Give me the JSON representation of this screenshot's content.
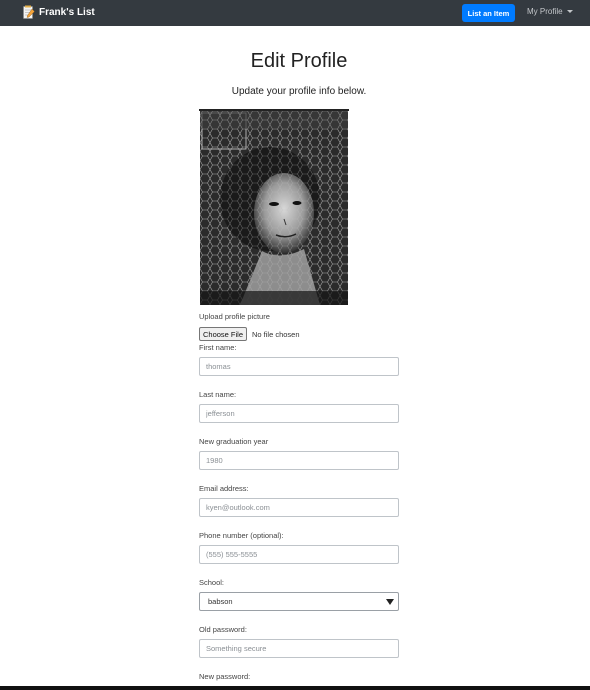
{
  "navbar": {
    "brand": "Frank's List",
    "list_item_label": "List an Item",
    "profile_menu_label": "My Profile"
  },
  "page": {
    "title": "Edit Profile",
    "subtitle": "Update your profile info below."
  },
  "upload": {
    "label": "Upload profile picture",
    "button_label": "Choose File",
    "status": "No file chosen"
  },
  "form": {
    "first_name": {
      "label": "First name:",
      "placeholder": "thomas"
    },
    "last_name": {
      "label": "Last name:",
      "placeholder": "jefferson"
    },
    "grad_year": {
      "label": "New graduation year",
      "placeholder": "1980"
    },
    "email": {
      "label": "Email address:",
      "placeholder": "kyen@outlook.com"
    },
    "phone": {
      "label": "Phone number (optional):",
      "placeholder": "(555) 555-5555"
    },
    "school": {
      "label": "School:",
      "selected": "babson"
    },
    "old_password": {
      "label": "Old password:",
      "placeholder": "Something secure"
    },
    "new_password": {
      "label": "New password:"
    }
  },
  "colors": {
    "navbar_bg": "#343a40",
    "primary": "#007bff"
  },
  "icons": {
    "brand": "notepad-pencil-icon",
    "menu_caret": "caret-down-icon",
    "select_arrow": "select-arrow-icon"
  }
}
